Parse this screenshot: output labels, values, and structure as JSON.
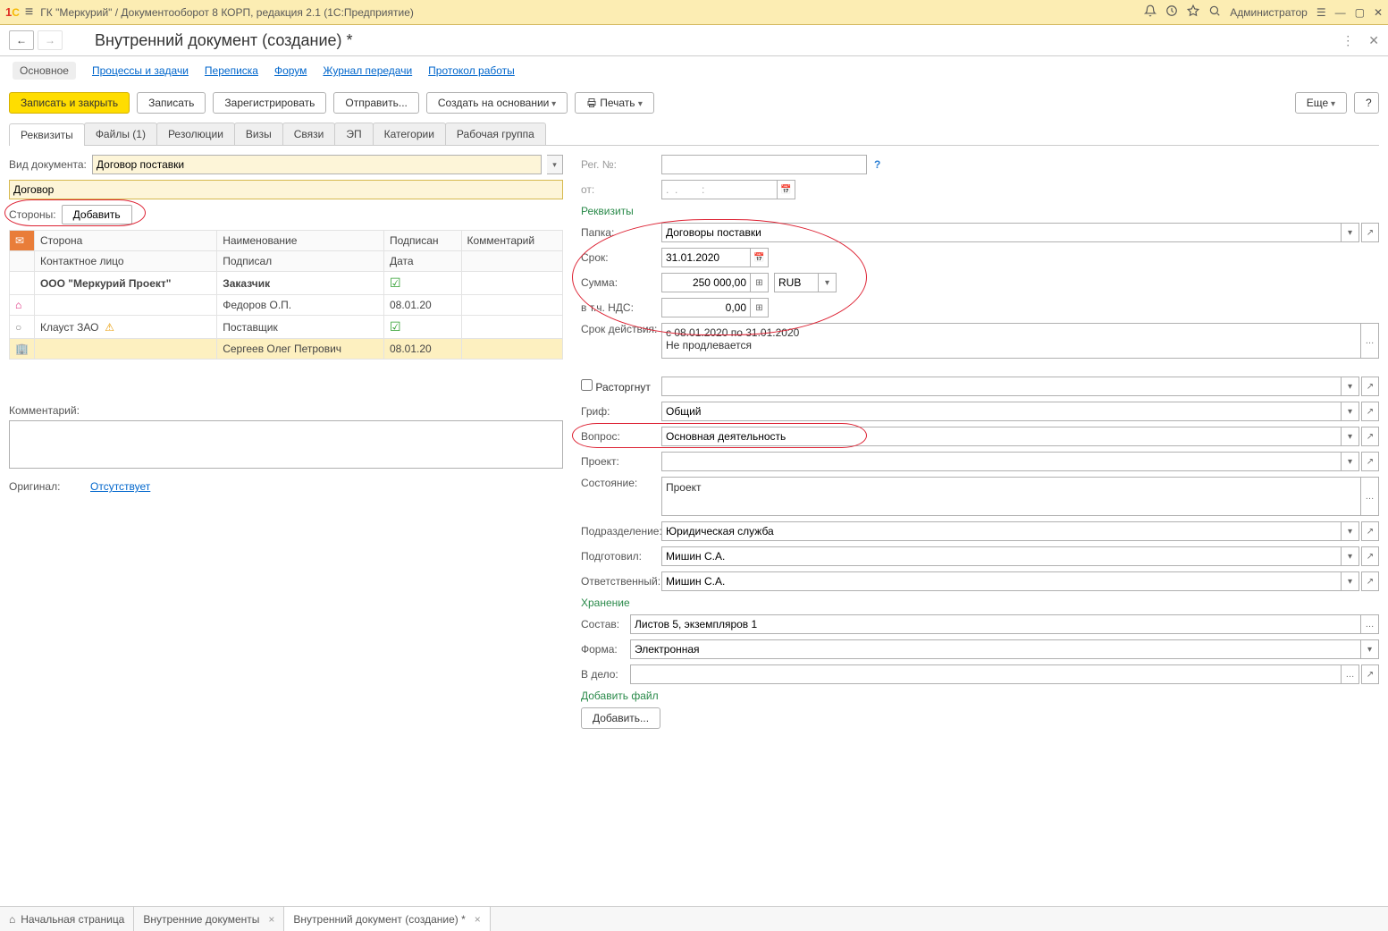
{
  "titlebar": {
    "app": "ГК \"Меркурий\" / Документооборот 8 КОРП, редакция 2.1  (1С:Предприятие)",
    "user": "Администратор"
  },
  "page": {
    "title": "Внутренний документ (создание) *"
  },
  "nav_links": {
    "main": "Основное",
    "processes": "Процессы и задачи",
    "correspondence": "Переписка",
    "forum": "Форум",
    "journal": "Журнал передачи",
    "protocol": "Протокол работы"
  },
  "actions": {
    "save_close": "Записать и закрыть",
    "save": "Записать",
    "register": "Зарегистрировать",
    "send": "Отправить...",
    "create_by": "Создать на основании",
    "print": "Печать",
    "more": "Еще",
    "help": "?"
  },
  "tabs": {
    "t0": "Реквизиты",
    "t1": "Файлы (1)",
    "t2": "Резолюции",
    "t3": "Визы",
    "t4": "Связи",
    "t5": "ЭП",
    "t6": "Категории",
    "t7": "Рабочая группа"
  },
  "left_form": {
    "doc_type_lbl": "Вид документа:",
    "doc_type_val": "Договор поставки",
    "name_val": "Договор",
    "parties_lbl": "Стороны:",
    "add_btn": "Добавить",
    "col_side": "Сторона",
    "col_name": "Наименование",
    "col_signed": "Подписан",
    "col_comment": "Комментарий",
    "col_contact": "Контактное лицо",
    "col_signer": "Подписал",
    "col_date": "Дата",
    "row1_side": "ООО \"Меркурий Проект\"",
    "row1_name": "Заказчик",
    "row1_signer": "Федоров О.П.",
    "row1_date": "08.01.20",
    "row2_side": "Клауст ЗАО",
    "row2_name": "Поставщик",
    "row2_signer": "Сергеев Олег Петрович",
    "row2_date": "08.01.20",
    "comment_lbl": "Комментарий:",
    "original_lbl": "Оригинал:",
    "original_val": "Отсутствует"
  },
  "right_form": {
    "regno_lbl": "Рег. №:",
    "from_lbl": "от:",
    "from_placeholder": ".  .        :",
    "sec_req": "Реквизиты",
    "folder_lbl": "Папка:",
    "folder_val": "Договоры поставки",
    "term_lbl": "Срок:",
    "term_val": "31.01.2020",
    "sum_lbl": "Сумма:",
    "sum_val": "250 000,00",
    "currency": "RUB",
    "vat_lbl": "в т.ч. НДС:",
    "vat_val": "0,00",
    "validity_lbl": "Срок действия:",
    "validity_val": "с 08.01.2020 по 31.01.2020\nНе продлевается",
    "terminated_lbl": "Расторгнут",
    "grif_lbl": "Гриф:",
    "grif_val": "Общий",
    "question_lbl": "Вопрос:",
    "question_val": "Основная деятельность",
    "project_lbl": "Проект:",
    "state_lbl": "Состояние:",
    "state_val": "Проект",
    "dept_lbl": "Подразделение:",
    "dept_val": "Юридическая служба",
    "prepared_lbl": "Подготовил:",
    "prepared_val": "Мишин С.А.",
    "responsible_lbl": "Ответственный:",
    "responsible_val": "Мишин С.А.",
    "sec_storage": "Хранение",
    "contents_lbl": "Состав:",
    "contents_val": "Листов 5, экземпляров 1",
    "form_lbl": "Форма:",
    "form_val": "Электронная",
    "tofile_lbl": "В дело:",
    "sec_addfile": "Добавить файл",
    "addfile_btn": "Добавить..."
  },
  "taskbar": {
    "home": "Начальная страница",
    "t1": "Внутренние документы",
    "t2": "Внутренний документ (создание) *"
  }
}
